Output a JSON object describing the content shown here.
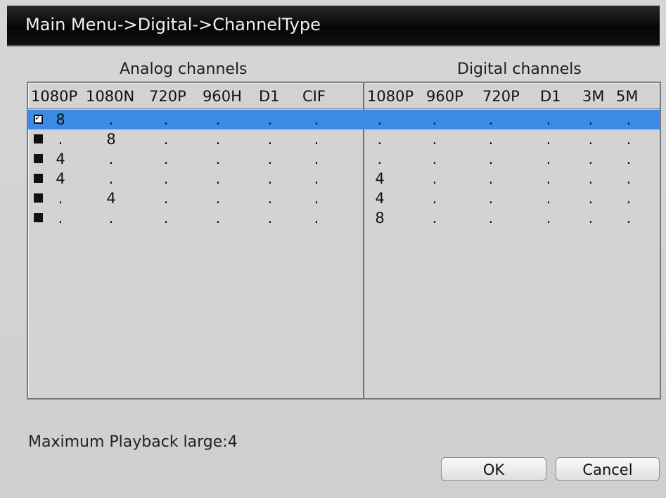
{
  "title": "Main Menu->Digital->ChannelType",
  "analog_title": "Analog channels",
  "digital_title": "Digital channels",
  "analog_columns": [
    "1080P",
    "1080N",
    "720P",
    "960H",
    "D1",
    "CIF"
  ],
  "digital_columns": [
    "1080P",
    "960P",
    "720P",
    "D1",
    "3M",
    "5M"
  ],
  "rows": [
    {
      "checked": true,
      "selected": true,
      "analog": [
        "8",
        ".",
        ".",
        ".",
        ".",
        "."
      ],
      "digital": [
        ".",
        ".",
        ".",
        ".",
        ".",
        "."
      ]
    },
    {
      "checked": false,
      "selected": false,
      "analog": [
        ".",
        "8",
        ".",
        ".",
        ".",
        "."
      ],
      "digital": [
        ".",
        ".",
        ".",
        ".",
        ".",
        "."
      ]
    },
    {
      "checked": false,
      "selected": false,
      "analog": [
        "4",
        ".",
        ".",
        ".",
        ".",
        "."
      ],
      "digital": [
        ".",
        ".",
        ".",
        ".",
        ".",
        "."
      ]
    },
    {
      "checked": false,
      "selected": false,
      "analog": [
        "4",
        ".",
        ".",
        ".",
        ".",
        "."
      ],
      "digital": [
        "4",
        ".",
        ".",
        ".",
        ".",
        "."
      ]
    },
    {
      "checked": false,
      "selected": false,
      "analog": [
        ".",
        "4",
        ".",
        ".",
        ".",
        "."
      ],
      "digital": [
        "4",
        ".",
        ".",
        ".",
        ".",
        "."
      ]
    },
    {
      "checked": false,
      "selected": false,
      "analog": [
        ".",
        ".",
        ".",
        ".",
        ".",
        "."
      ],
      "digital": [
        "8",
        ".",
        ".",
        ".",
        ".",
        "."
      ]
    }
  ],
  "footer": {
    "max_playback": "Maximum Playback large:4"
  },
  "buttons": {
    "ok": "OK",
    "cancel": "Cancel"
  },
  "colors": {
    "selection": "#3a8ae6",
    "title_bar": "#050505"
  }
}
